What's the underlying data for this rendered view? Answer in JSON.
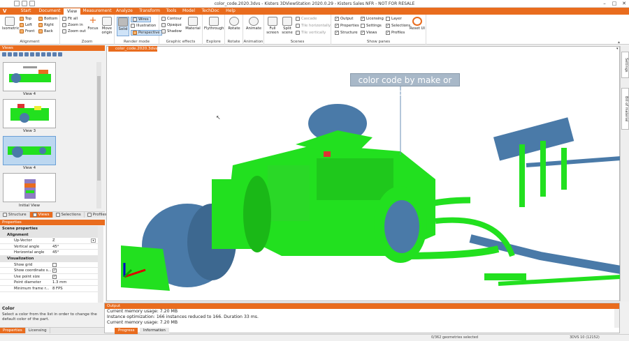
{
  "window": {
    "title": "color_code.2020.3dvs - Kisters 3DViewStation 2020.0.29 - Kisters Sales NFR - NOT FOR RESALE",
    "minimize": "–",
    "maximize": "□",
    "close": "✕"
  },
  "menu": {
    "logo": "V",
    "tabs": [
      "Start",
      "Document",
      "View",
      "Measurement",
      "Analyze",
      "Transform",
      "Tools",
      "Model",
      "TechDoc",
      "Help"
    ],
    "active": "View"
  },
  "ribbon": {
    "alignment": {
      "label": "Alignment",
      "isometric": "Isometric",
      "top": "Top",
      "bottom": "Bottom",
      "left": "Left",
      "right": "Right",
      "front": "Front",
      "back": "Back"
    },
    "zoom": {
      "label": "Zoom",
      "fit_all": "Fit all",
      "zoom_in": "Zoom in",
      "zoom_out": "Zoom out",
      "focus": "Focus",
      "move_origin": "Move origin"
    },
    "render": {
      "label": "Render mode",
      "solid": "Solid",
      "wires": "Wires",
      "illustration": "Illustration",
      "perspective": "Perspective"
    },
    "effects": {
      "label": "Graphic effects",
      "contour": "Contour",
      "opaque": "Opaque",
      "shadow": "Shadow",
      "material": "Material"
    },
    "explore": {
      "label": "Explore",
      "flythrough": "Flythrough"
    },
    "rotate": {
      "label": "Rotate",
      "rotate": "Rotate"
    },
    "animation": {
      "label": "Animation",
      "animate": "Animate"
    },
    "scenes": {
      "label": "Scenes",
      "full_screen": "Full screen",
      "split_scene": "Split scene",
      "cascade": "Cascade",
      "tile_h": "Tile horizontally",
      "tile_v": "Tile vertically"
    },
    "panes": {
      "label": "Show panes",
      "output": "Output",
      "properties": "Properties",
      "structure": "Structure",
      "licensing": "Licensing",
      "settings": "Settings",
      "views": "Views",
      "layer": "Layer",
      "selections": "Selections",
      "profiles": "Profiles",
      "reset": "Reset UI"
    }
  },
  "views_panel": {
    "title": "Views",
    "items": [
      "View 4",
      "View 3",
      "View 4",
      "Initial View"
    ],
    "selected_index": 2
  },
  "left_tabs": [
    "Structure",
    "Views",
    "Selections",
    "Profiles"
  ],
  "left_active": "Views",
  "properties": {
    "title": "Properties",
    "scene": "Scene properties",
    "alignment": "Alignment",
    "rows": [
      {
        "k": "Up-Vector",
        "v": "Z"
      },
      {
        "k": "Vertical angle",
        "v": "45°"
      },
      {
        "k": "Horizontal angle",
        "v": "45°"
      }
    ],
    "visualization": "Visualization",
    "vis_rows": [
      {
        "k": "Show grid",
        "v": ""
      },
      {
        "k": "Show coordinate s...",
        "v": "✓"
      },
      {
        "k": "Use point size",
        "v": "✓"
      },
      {
        "k": "Point diameter",
        "v": "1.3 mm"
      },
      {
        "k": "Minimum frame r...",
        "v": "8 FPS"
      }
    ],
    "help_title": "Color",
    "help_text": "Select a color from the list in order to change the default color of the part."
  },
  "bottom_left_tabs": [
    "Properties",
    "Licensing"
  ],
  "document_tab": "color_code.2020.3dvs",
  "viewport": {
    "label": "color code by make or buy"
  },
  "right_tabs": [
    "Settings",
    "Bill of material"
  ],
  "output": {
    "title": "Output",
    "lines": [
      "Current memory usage: 7.20 MB",
      "Instance optimization: 166 instances reduced to 166. Duration 33 ms.",
      "Current memory usage: 7.20 MB"
    ]
  },
  "output_tabs": [
    "Progress",
    "Information"
  ],
  "status": {
    "geometries": "0/362 geometries selected",
    "version": "3DVS 10 (12152)"
  },
  "colors": {
    "accent": "#e96c1e",
    "make": "#22e01f",
    "buy": "#4a7aa8"
  }
}
